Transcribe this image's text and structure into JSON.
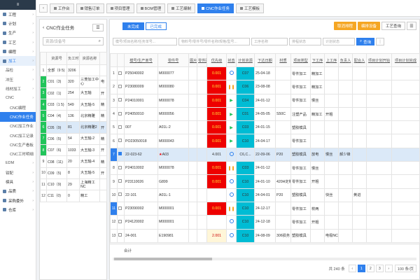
{
  "sidebar": {
    "items": [
      {
        "label": "工程",
        "kind": "top"
      },
      {
        "label": "计划",
        "kind": "top"
      },
      {
        "label": "生产",
        "kind": "top"
      },
      {
        "label": "工艺",
        "kind": "top"
      },
      {
        "label": "编程",
        "kind": "top"
      },
      {
        "label": "加工",
        "kind": "group"
      },
      {
        "label": "品检",
        "kind": "sub"
      },
      {
        "label": "冲压",
        "kind": "sub"
      },
      {
        "label": "线材加工",
        "kind": "sub"
      },
      {
        "label": "CNC",
        "kind": "sub"
      },
      {
        "label": "CNC编程",
        "kind": "sub2"
      },
      {
        "label": "CNC作业任务",
        "kind": "active"
      },
      {
        "label": "CNC加工作业",
        "kind": "sub2"
      },
      {
        "label": "CNC加工记录",
        "kind": "sub2"
      },
      {
        "label": "CNC生产看板",
        "kind": "sub2"
      },
      {
        "label": "CNC工时明细",
        "kind": "sub2"
      },
      {
        "label": "EDM",
        "kind": "sub"
      },
      {
        "label": "钳配",
        "kind": "sub"
      },
      {
        "label": "模具",
        "kind": "sub"
      },
      {
        "label": "品质",
        "kind": "top"
      },
      {
        "label": "采购委外",
        "kind": "top"
      },
      {
        "label": "仓库",
        "kind": "top"
      }
    ]
  },
  "tabs": [
    {
      "label": "工作台"
    },
    {
      "label": "销售订单"
    },
    {
      "label": "项目管理"
    },
    {
      "label": "BOM管理"
    },
    {
      "label": "工艺编制"
    },
    {
      "label": "CNC作业任务",
      "active": true
    },
    {
      "label": "工艺模板"
    }
  ],
  "left_panel": {
    "title": "CNC作业任务",
    "search_placeholder": "资源/设备号",
    "columns": [
      "",
      "资源号",
      "负工时",
      "资源名称",
      ""
    ],
    "rows": [
      {
        "n": "1",
        "code": "全部（9 5)",
        "hours": "3206",
        "name": "",
        "extra": "",
        "green": false
      },
      {
        "n": "2",
        "code": "C01（3)",
        "hours": "320",
        "name": "三菱加工中心",
        "extra": "电",
        "green": true
      },
      {
        "n": "3",
        "code": "C02（1)",
        "hours": "254",
        "name": "大玉轴",
        "extra": "开",
        "green": true
      },
      {
        "n": "4",
        "code": "C03（1 5)",
        "hours": "549",
        "name": "大玉轴-5",
        "extra": "精",
        "green": true
      },
      {
        "n": "5",
        "code": "C04（4)",
        "hours": "136",
        "name": "北京精雕",
        "extra": "精",
        "green": true
      },
      {
        "n": "6",
        "code": "C05（9)",
        "hours": "81",
        "name": "北京精雕2",
        "extra": "开",
        "green": true,
        "selected": true
      },
      {
        "n": "7",
        "code": "C06（5)",
        "hours": "54",
        "name": "大玉轴-2",
        "extra": "精",
        "green": true
      },
      {
        "n": "8",
        "code": "C07（6)",
        "hours": "1033",
        "name": "大玉轴-3",
        "extra": "开",
        "green": true
      },
      {
        "n": "9",
        "code": "C08（11)",
        "hours": "20",
        "name": "大玉轴-4",
        "extra": "精",
        "green": false
      },
      {
        "n": "10",
        "code": "C09（5)",
        "hours": "8",
        "name": "大玉轴-5",
        "extra": "开",
        "green": false
      },
      {
        "n": "11",
        "code": "C10（9)",
        "hours": "29",
        "name": "上海精工NC",
        "extra": "",
        "green": false
      },
      {
        "n": "12",
        "code": "C11（0)",
        "hours": "0",
        "name": "精工",
        "extra": "",
        "green": false
      }
    ]
  },
  "main": {
    "status_tabs": [
      "未完成",
      "已完成"
    ],
    "buttons": {
      "b1": "取消排程",
      "b2": "编排设备",
      "b3": "工艺查询"
    },
    "filters": {
      "f1": "模号/项目名称/任务单号...",
      "f2": "物料号/零件号/零件名称/规格/型号...",
      "f3": "工序名称",
      "f4": "排程状态",
      "f5": "计划状态",
      "search": "查询"
    },
    "columns": [
      "",
      "",
      "模号/生产单号",
      "零件号",
      "图片",
      "零件图",
      "优先级",
      "状态",
      "计划资源",
      "下达日期",
      "材质",
      "项目类型",
      "下工序",
      "上工序",
      "负责人",
      "配合人",
      "项目计划开始",
      "项目计划完成"
    ],
    "rows": [
      {
        "n": "1",
        "mold": "P25040002",
        "part": "M000077",
        "pri": "0.001",
        "status": "clock",
        "res": "C07",
        "date": "25-04-18",
        "mat": "",
        "type": "零件加工",
        "next": "精加工",
        "prev": "",
        "owner": "",
        "partner": ""
      },
      {
        "n": "2",
        "mold": "P23080009",
        "part": "M000080",
        "pri": "0.001",
        "status": "pause",
        "res": "C06",
        "date": "23-08-08",
        "mat": "",
        "type": "零件加工",
        "next": "精加工",
        "prev": "",
        "owner": "",
        "partner": ""
      },
      {
        "n": "3",
        "mold": "P24010001",
        "part": "M000078",
        "pri": "0.001",
        "status": "play",
        "res": "C04",
        "date": "24-01-12",
        "mat": "",
        "type": "零件加工",
        "next": "慢丝",
        "prev": "",
        "owner": "",
        "partner": ""
      },
      {
        "n": "4",
        "mold": "P24050010",
        "part": "M000056",
        "pri": "0.001",
        "status": "play",
        "res": "C01",
        "date": "24-05-05",
        "mat": "S50C",
        "type": "注塑产品",
        "next": "精加工",
        "prev": "开粗",
        "owner": "",
        "partner": ""
      },
      {
        "n": "5",
        "mold": "007",
        "part": "A01L-2",
        "pri": "0.001",
        "status": "play",
        "res": "C03",
        "date": "24-01-15",
        "mat": "",
        "type": "塑胶模具",
        "next": "",
        "prev": "",
        "owner": "",
        "partner": ""
      },
      {
        "n": "6",
        "mold": "PO23050018",
        "part": "M000043",
        "pri": "0.001",
        "status": "play",
        "res": "C10",
        "date": "24-04-17",
        "mat": "",
        "type": "零件加工",
        "next": "",
        "prev": "",
        "owner": "",
        "partner": ""
      },
      {
        "n": "7",
        "mold": "22-023-62",
        "part": "A03",
        "pri": "4.001",
        "status": "clock",
        "res": "C6,C...",
        "date": "22-09-06",
        "mat": "P20",
        "type": "塑胶模具",
        "next": "放电",
        "prev": "慢丝",
        "owner": "郝少锋",
        "partner": "",
        "star": true,
        "selected": true
      },
      {
        "n": "8",
        "mold": "P24010002",
        "part": "M000078",
        "pri": "0.001",
        "status": "pause",
        "res": "C03",
        "date": "24-01-12",
        "mat": "",
        "type": "零件加工",
        "next": "慢丝",
        "prev": "",
        "owner": "",
        "partner": ""
      },
      {
        "n": "9",
        "mold": "P23110026",
        "part": "G899",
        "pri": "0.001",
        "status": "clock",
        "res": "C10",
        "date": "24-01-10",
        "mat": "420H定制",
        "type": "零件加工",
        "next": "开粗",
        "prev": "",
        "owner": "",
        "partner": ""
      },
      {
        "n": "10",
        "mold": "22-101",
        "part": "A01L-1",
        "pri": "",
        "status": "clock",
        "res": "C10",
        "date": "24-04-01",
        "mat": "P20",
        "type": "塑胶模具",
        "next": "",
        "prev": "快丝",
        "owner": "",
        "partner": "黄进"
      },
      {
        "n": "11",
        "mold": "P23090002",
        "part": "M000001",
        "pri": "0.001",
        "status": "pause",
        "res": "C10",
        "date": "24-12-17",
        "mat": "",
        "type": "零件加工",
        "next": "校两",
        "prev": "",
        "owner": "",
        "partner": ""
      },
      {
        "n": "12",
        "mold": "P24120002",
        "part": "M000001",
        "pri": "",
        "status": "clock",
        "res": "C10",
        "date": "24-12-18",
        "mat": "",
        "type": "零件加工",
        "next": "开粗",
        "prev": "",
        "owner": "",
        "partner": ""
      },
      {
        "n": "13",
        "mold": "24-001",
        "part": "E190981",
        "pri": "2.001",
        "status": "clock",
        "res": "C10",
        "date": "24-08-09",
        "mat": "306损务",
        "type": "塑胶模具",
        "next": "",
        "prev": "电极NC",
        "owner": "",
        "partner": ""
      }
    ],
    "summary_label": "合计",
    "pager": {
      "total": "共 240 条",
      "pages": [
        "1",
        "2",
        "3"
      ],
      "page_size": "100 条/页"
    }
  },
  "colors": {
    "primary": "#2f80ed",
    "priority": "#e00000",
    "resource": "#00bcd4",
    "green": "#21c45a",
    "orange": "#f5a623"
  }
}
